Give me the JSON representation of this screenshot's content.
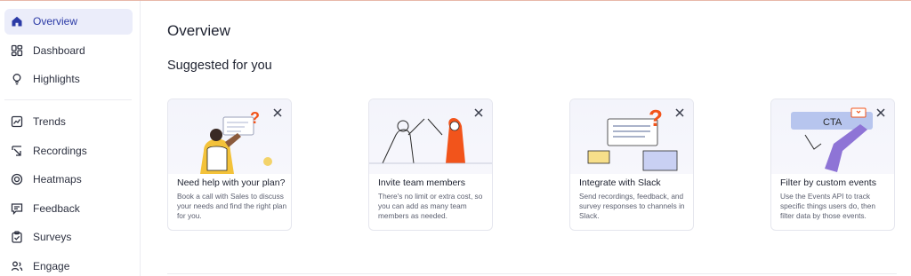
{
  "sidebar": {
    "items": [
      {
        "label": "Overview",
        "icon": "home-icon",
        "active": true
      },
      {
        "label": "Dashboard",
        "icon": "dashboard-icon",
        "active": false
      },
      {
        "label": "Highlights",
        "icon": "lightbulb-icon",
        "active": false
      },
      {
        "label": "Trends",
        "icon": "trend-chart-icon",
        "active": false
      },
      {
        "label": "Recordings",
        "icon": "recordings-icon",
        "active": false
      },
      {
        "label": "Heatmaps",
        "icon": "heatmap-icon",
        "active": false
      },
      {
        "label": "Feedback",
        "icon": "feedback-icon",
        "active": false
      },
      {
        "label": "Surveys",
        "icon": "survey-clipboard-icon",
        "active": false
      },
      {
        "label": "Engage",
        "icon": "engage-users-icon",
        "active": false
      }
    ]
  },
  "main": {
    "title": "Overview",
    "section_title": "Suggested for you",
    "cards": [
      {
        "title": "Need help with your plan?",
        "description": "Book a call with Sales to discuss your needs and find the right plan for you."
      },
      {
        "title": "Invite team members",
        "description": "There's no limit or extra cost, so you can add as many team members as needed."
      },
      {
        "title": "Integrate with Slack",
        "description": "Send recordings, feedback, and survey responses to channels in Slack."
      },
      {
        "title": "Filter by custom events",
        "description": "Use the Events API to track specific things users do, then filter data by those events.",
        "art_label": "CTA"
      }
    ]
  },
  "colors": {
    "accent": "#2b3aa6",
    "active_bg": "#ebedfa",
    "orange": "#f2541b",
    "purple": "#8e74d6"
  }
}
